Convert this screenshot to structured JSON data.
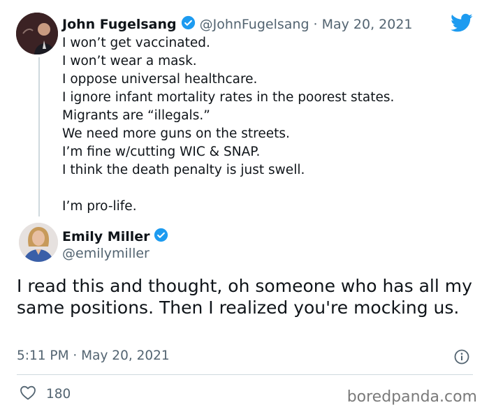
{
  "quoted_tweet": {
    "author_name": "John Fugelsang",
    "author_handle": "@JohnFugelsang",
    "separator": "·",
    "date": "May 20, 2021",
    "lines": [
      "I won’t get vaccinated.",
      "I won’t wear a mask.",
      "I oppose universal healthcare.",
      "I ignore infant mortality rates in the poorest states.",
      "Migrants are “illegals.”",
      "We need more guns on the streets.",
      "I’m fine w/cutting WIC & SNAP.",
      "I think the death penalty is just swell.",
      "",
      "I’m pro-life."
    ]
  },
  "reply_tweet": {
    "author_name": "Emily Miller",
    "author_handle": "@emilymiller",
    "text": "I read this and thought, oh someone who has all my same positions. Then I realized you're mocking us.",
    "timestamp": "5:11 PM · May 20, 2021",
    "like_count": "180"
  },
  "watermark": "boredpanda.com",
  "colors": {
    "twitter_blue": "#1d9bf0",
    "verified_blue": "#1d9bf0",
    "text_primary": "#0f1419",
    "text_secondary": "#536471",
    "divider": "#cfd9de"
  },
  "icons": [
    "twitter-bird-icon",
    "verified-badge-icon",
    "info-icon",
    "heart-icon"
  ]
}
